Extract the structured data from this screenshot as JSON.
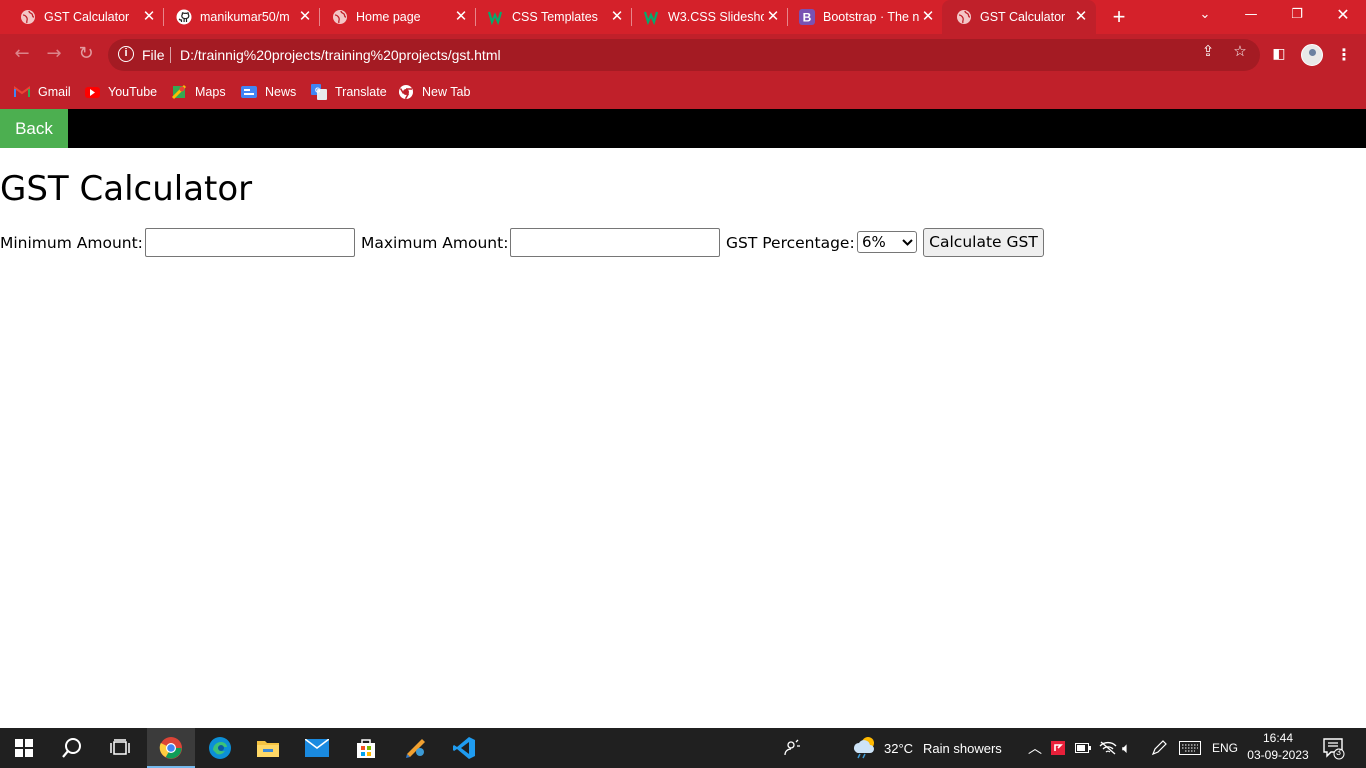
{
  "browser": {
    "tabs": [
      {
        "title": "GST Calculator",
        "favicon": "globe-icon",
        "active": false
      },
      {
        "title": "manikumar50/m",
        "favicon": "github-icon",
        "active": false
      },
      {
        "title": "Home page",
        "favicon": "globe-icon",
        "active": false
      },
      {
        "title": "CSS Templates",
        "favicon": "w3schools-icon",
        "active": false
      },
      {
        "title": "W3.CSS Slidesho",
        "favicon": "w3schools-icon",
        "active": false
      },
      {
        "title": "Bootstrap · The n",
        "favicon": "bootstrap-icon",
        "active": false
      },
      {
        "title": "GST Calculator",
        "favicon": "globe-icon",
        "active": true
      }
    ],
    "new_tab": "+",
    "address": {
      "scheme_label": "File",
      "url": "D:/trainnig%20projects/training%20projects/gst.html"
    },
    "bookmarks": [
      {
        "label": "Gmail",
        "icon": "gmail-icon"
      },
      {
        "label": "YouTube",
        "icon": "youtube-icon"
      },
      {
        "label": "Maps",
        "icon": "maps-icon"
      },
      {
        "label": "News",
        "icon": "news-icon"
      },
      {
        "label": "Translate",
        "icon": "translate-icon"
      },
      {
        "label": "New Tab",
        "icon": "chrome-icon"
      }
    ],
    "theme_color": "#d4212a"
  },
  "page": {
    "back_label": "Back",
    "title": "GST Calculator",
    "form": {
      "min_label": "Minimum Amount:",
      "min_value": "",
      "max_label": "Maximum Amount:",
      "max_value": "",
      "gst_label": "GST Percentage:",
      "gst_selected": "6%",
      "submit_label": "Calculate GST"
    },
    "back_color": "#4caf50"
  },
  "taskbar": {
    "weather": {
      "temp": "32°C",
      "condition": "Rain showers"
    },
    "language": "ENG",
    "time": "16:44",
    "date": "03-09-2023",
    "notifications": "3"
  }
}
